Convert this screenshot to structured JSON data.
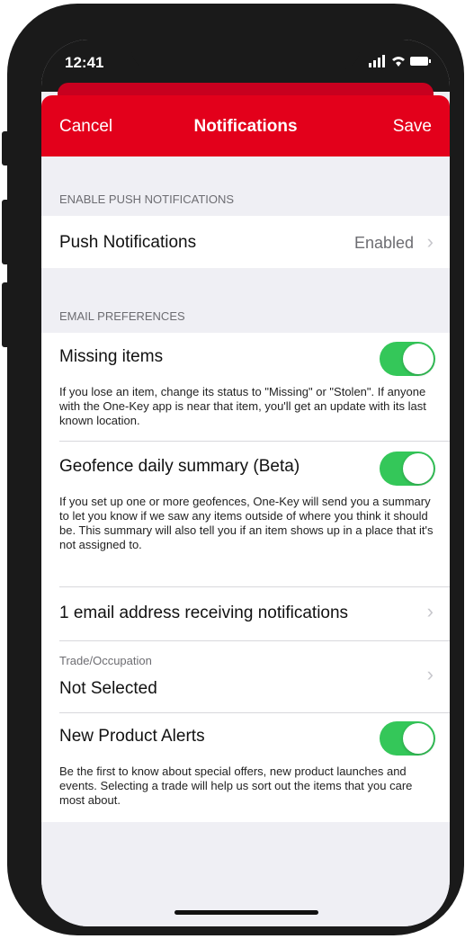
{
  "status": {
    "time": "12:41",
    "icons": "..ıl ≈ ▭"
  },
  "nav": {
    "cancel": "Cancel",
    "title": "Notifications",
    "save": "Save"
  },
  "push_section": {
    "header": "ENABLE PUSH NOTIFICATIONS",
    "row_label": "Push Notifications",
    "row_value": "Enabled"
  },
  "email_section": {
    "header": "EMAIL PREFERENCES",
    "missing": {
      "label": "Missing items",
      "desc": "If you lose an item, change its status to \"Missing\" or \"Stolen\". If anyone with the One-Key app is near that item, you'll get an update with its last known location.",
      "enabled": true
    },
    "geofence": {
      "label": "Geofence daily summary (Beta)",
      "desc": "If you set up one or more geofences, One-Key will send you a summary to let you know if we saw any items outside of where you think it should be. This summary will also tell you if an item shows up in a place that it's not assigned to.",
      "enabled": true
    },
    "email_row": "1 email address receiving notifications",
    "trade": {
      "label": "Trade/Occupation",
      "value": "Not Selected"
    },
    "product": {
      "label": "New Product Alerts",
      "desc": "Be the first to know about special offers, new product launches and events. Selecting a trade will help us sort out the items that you care most about.",
      "enabled": true
    }
  },
  "colors": {
    "accent": "#e3001b",
    "toggle_on": "#34c759"
  }
}
